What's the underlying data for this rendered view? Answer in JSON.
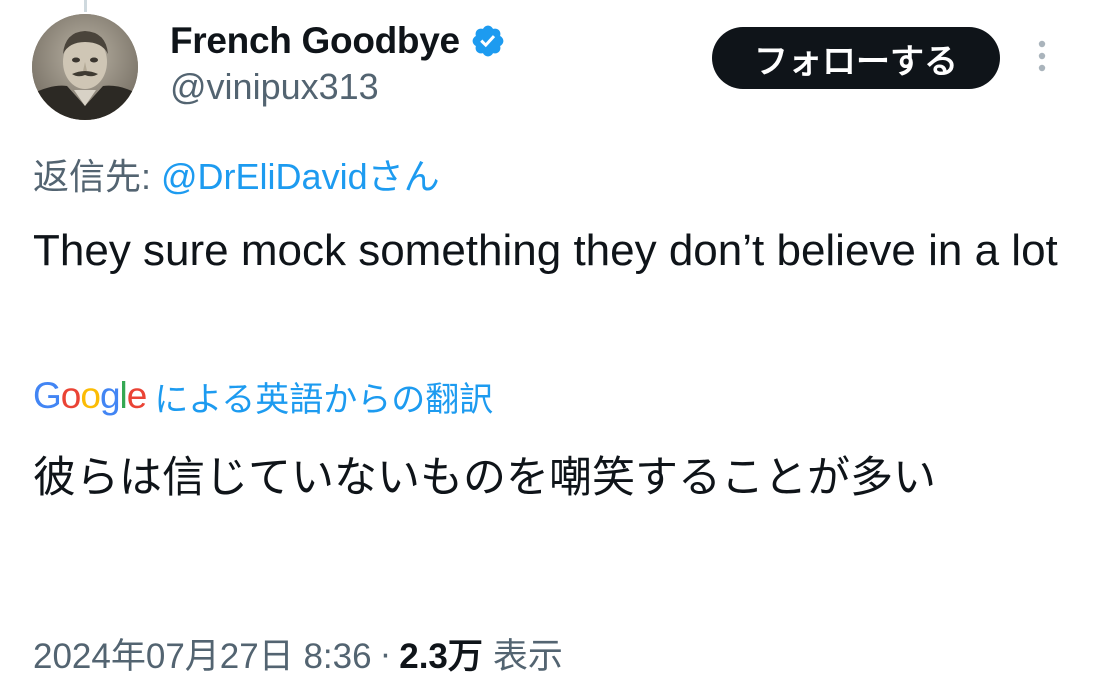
{
  "author": {
    "display_name": "French Goodbye",
    "handle": "@vinipux313",
    "verified": true,
    "verified_color": "#1d9bf0",
    "avatar_icon": "vintage-portrait-avatar"
  },
  "actions": {
    "follow_label": "フォローする",
    "more_icon": "vertical-ellipsis-icon"
  },
  "reply": {
    "prefix": "返信先: ",
    "handle": "@DrEliDavid",
    "suffix": "さん"
  },
  "tweet": {
    "text": "They sure mock something they don’t believe in a lot"
  },
  "translation": {
    "google_letters": [
      "G",
      "o",
      "o",
      "g",
      "l",
      "e"
    ],
    "label": "による英語からの翻訳",
    "text": "彼らは信じていないものを嘲笑することが多い"
  },
  "meta": {
    "date": "2024年07月27日 8:36",
    "separator": "·",
    "views_count": "2.3万",
    "views_label": "表示"
  },
  "colors": {
    "link": "#1d9bf0",
    "secondary_text": "#536471",
    "primary_text": "#0f1419",
    "follow_bg": "#0f1419"
  }
}
